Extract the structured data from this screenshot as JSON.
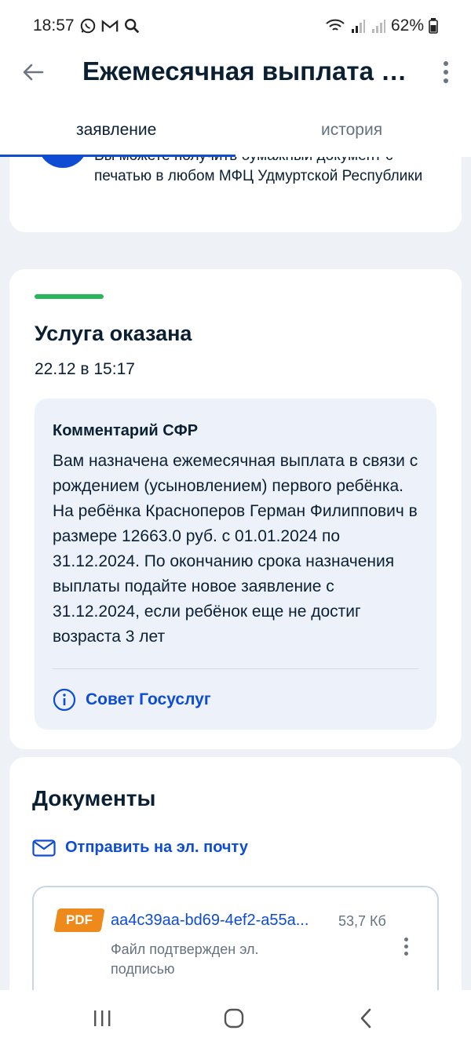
{
  "status_bar": {
    "time": "18:57",
    "battery": "62%"
  },
  "header": {
    "title": "Ежемесячная выплата пр..."
  },
  "tabs": [
    {
      "label": "заявление",
      "active": true
    },
    {
      "label": "история",
      "active": false
    }
  ],
  "mfc_card": {
    "text": "Вы можете получить бумажный документ с печатью в любом МФЦ Удмуртской Республики"
  },
  "status_card": {
    "title": "Услуга оказана",
    "date": "22.12 в 15:17",
    "comment_heading": "Комментарий СФР",
    "comment_body": "Вам назначена ежемесячная выплата в связи с рождением (усыновлением) первого ребёнка. На ребёнка Красноперов Герман Филиппович в размере 12663.0 руб. с 01.01.2024 по 31.12.2024. По окончанию срока назначения выплаты подайте новое заявление с 31.12.2024, если ребёнок еще не достиг возраста 3 лет",
    "tip_label": "Совет Госуслуг"
  },
  "documents": {
    "title": "Документы",
    "email_label": "Отправить на эл. почту",
    "files": [
      {
        "type": "PDF",
        "name": "aa4c39aa-bd69-4ef2-a55a...",
        "size": "53,7 Кб",
        "note": "Файл подтвержден эл. подписью"
      }
    ]
  },
  "colors": {
    "accent": "#0d4cd3",
    "success": "#2ab55e",
    "pdf_badge": "#ee8a1c"
  }
}
